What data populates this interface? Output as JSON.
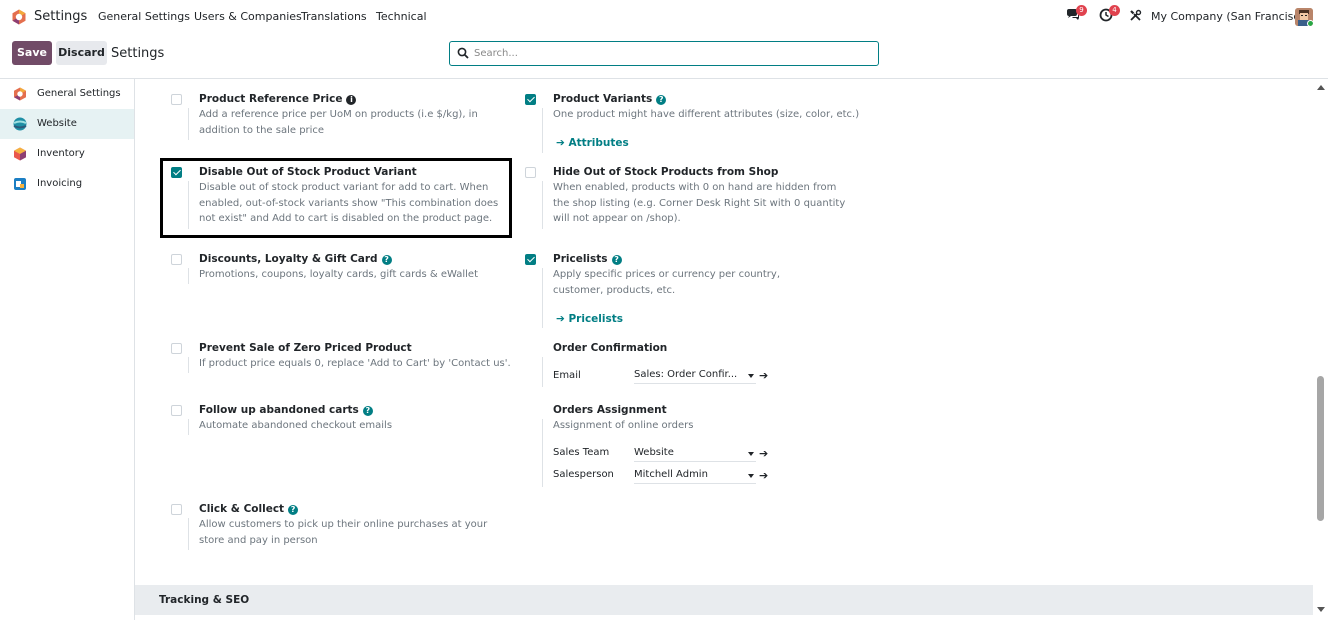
{
  "navbar": {
    "app_name": "Settings",
    "menu": [
      "General Settings",
      "Users & Companies",
      "Translations",
      "Technical"
    ],
    "messages_count": "9",
    "activities_count": "4",
    "company": "My Company (San Francisco)"
  },
  "control_panel": {
    "save_label": "Save",
    "discard_label": "Discard",
    "breadcrumb": "Settings",
    "search_placeholder": "Search..."
  },
  "sidebar": {
    "items": [
      {
        "label": "General Settings",
        "icon": "settings-app-icon",
        "active": false
      },
      {
        "label": "Website",
        "icon": "website-app-icon",
        "active": true
      },
      {
        "label": "Inventory",
        "icon": "inventory-app-icon",
        "active": false
      },
      {
        "label": "Invoicing",
        "icon": "invoicing-app-icon",
        "active": false
      }
    ]
  },
  "settings": {
    "product_reference_price": {
      "title": "Product Reference Price",
      "desc": "Add a reference price per UoM on products (i.e $/kg), in addition to the sale price",
      "checked": false
    },
    "product_variants": {
      "title": "Product Variants",
      "desc": "One product might have different attributes (size, color, etc.)",
      "link": "Attributes",
      "checked": true
    },
    "disable_oos_variant": {
      "title": "Disable Out of Stock Product Variant",
      "desc": "Disable out of stock product variant for add to cart. When enabled, out-of-stock variants show \"This combination does not exist\" and Add to cart is disabled on the product page.",
      "checked": true
    },
    "hide_oos_products": {
      "title": "Hide Out of Stock Products from Shop",
      "desc": "When enabled, products with 0 on hand are hidden from the shop listing (e.g. Corner Desk Right Sit with 0 quantity will not appear on /shop).",
      "checked": false
    },
    "discounts_loyalty": {
      "title": "Discounts, Loyalty & Gift Card",
      "desc": "Promotions, coupons, loyalty cards, gift cards & eWallet",
      "checked": false
    },
    "pricelists": {
      "title": "Pricelists",
      "desc": "Apply specific prices or currency per country, customer, products, etc.",
      "link": "Pricelists",
      "checked": true
    },
    "prevent_zero_price": {
      "title": "Prevent Sale of Zero Priced Product",
      "desc": "If product price equals 0, replace 'Add to Cart' by 'Contact us'.",
      "checked": false
    },
    "order_confirmation": {
      "title": "Order Confirmation",
      "email_label": "Email",
      "email_value": "Sales: Order Confir..."
    },
    "follow_up_carts": {
      "title": "Follow up abandoned carts",
      "desc": "Automate abandoned checkout emails",
      "checked": false
    },
    "orders_assignment": {
      "title": "Orders Assignment",
      "desc": "Assignment of online orders",
      "sales_team_label": "Sales Team",
      "sales_team_value": "Website",
      "salesperson_label": "Salesperson",
      "salesperson_value": "Mitchell Admin"
    },
    "click_collect": {
      "title": "Click & Collect",
      "desc": "Allow customers to pick up their online purchases at your store and pay in person",
      "checked": false
    }
  },
  "section_header": "Tracking & SEO",
  "colors": {
    "brand": "#714b67",
    "accent": "#017e84"
  }
}
